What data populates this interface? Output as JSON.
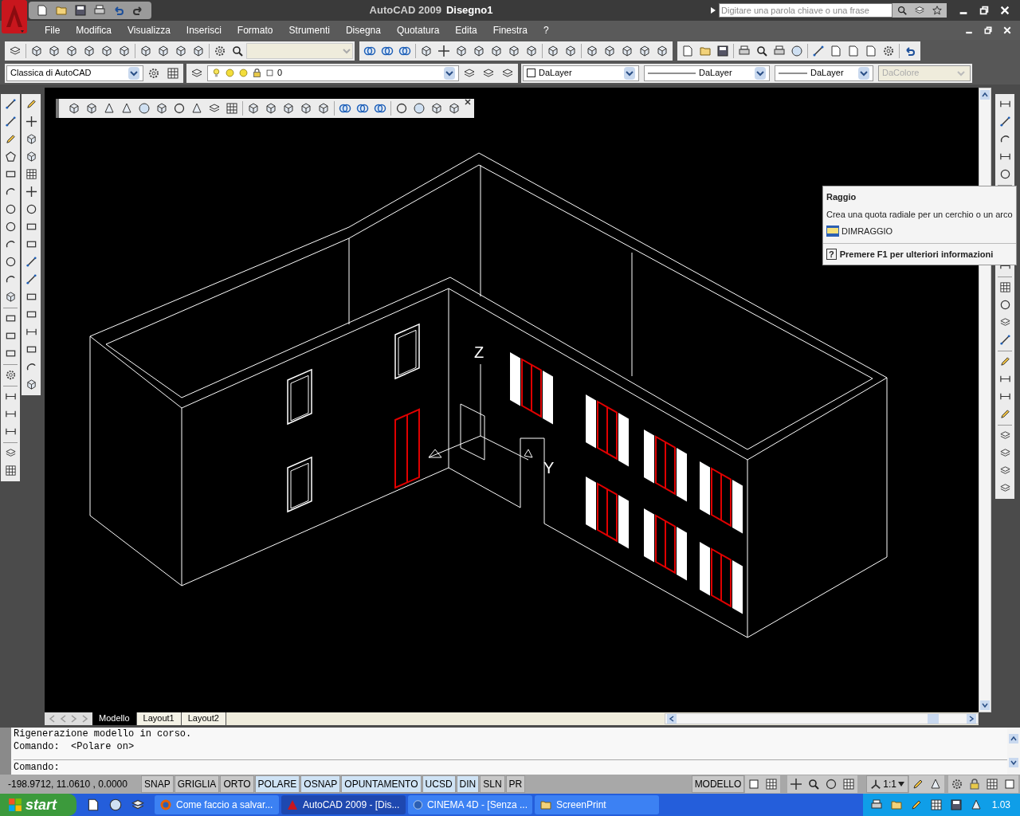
{
  "window": {
    "app_title": "AutoCAD 2009",
    "document_title": "Disegno1"
  },
  "search": {
    "placeholder": "Digitare una parola chiave o una frase"
  },
  "menu": [
    "File",
    "Modifica",
    "Visualizza",
    "Inserisci",
    "Formato",
    "Strumenti",
    "Disegna",
    "Quotatura",
    "Edita",
    "Finestra",
    "?"
  ],
  "workspace": {
    "value": "Classica di AutoCAD"
  },
  "layer": {
    "value": "0"
  },
  "properties": [
    {
      "kind": "color",
      "value": "DaLayer",
      "disabled": false
    },
    {
      "kind": "linetype",
      "value": "DaLayer",
      "disabled": false
    },
    {
      "kind": "lineweight",
      "value": "DaLayer",
      "disabled": false
    },
    {
      "kind": "plotstyle",
      "value": "DaColore",
      "disabled": true
    }
  ],
  "tooltip": {
    "title": "Raggio",
    "description": "Crea una quota radiale per un cerchio o un arco",
    "command": "DIMRAGGIO",
    "help_key": "?",
    "help": "Premere F1 per ulteriori informazioni"
  },
  "viewport": {
    "axis_labels": [
      "Z",
      "Y"
    ]
  },
  "layout_tabs": [
    {
      "label": "Modello",
      "selected": true
    },
    {
      "label": "Layout1",
      "selected": false
    },
    {
      "label": "Layout2",
      "selected": false
    }
  ],
  "command_line": {
    "history": [
      "Rigenerazione modello in corso.",
      "Comando:  <Polare on>"
    ],
    "prompt": "Comando:"
  },
  "status_bar": {
    "coordinates": "-198.9712, 11.0610 , 0.0000",
    "toggles": [
      {
        "label": "SNAP",
        "on": false
      },
      {
        "label": "GRIGLIA",
        "on": false
      },
      {
        "label": "ORTO",
        "on": false
      },
      {
        "label": "POLARE",
        "on": true
      },
      {
        "label": "OSNAP",
        "on": true
      },
      {
        "label": "OPUNTAMENTO",
        "on": true
      },
      {
        "label": "UCSD",
        "on": true
      },
      {
        "label": "DIN",
        "on": true
      },
      {
        "label": "SLN",
        "on": false
      },
      {
        "label": "PR",
        "on": false
      }
    ],
    "space": "MODELLO",
    "scale": "1:1"
  },
  "taskbar": {
    "start": "start",
    "tasks": [
      {
        "kind": "browser",
        "label": "Come faccio a salvar...",
        "selected": false
      },
      {
        "kind": "autocad",
        "label": "AutoCAD 2009 - [Dis...",
        "selected": true
      },
      {
        "kind": "globe",
        "label": "CINEMA 4D - [Senza ...",
        "selected": false
      },
      {
        "kind": "folder",
        "label": "ScreenPrint",
        "selected": false
      }
    ],
    "clock": "1.03"
  }
}
